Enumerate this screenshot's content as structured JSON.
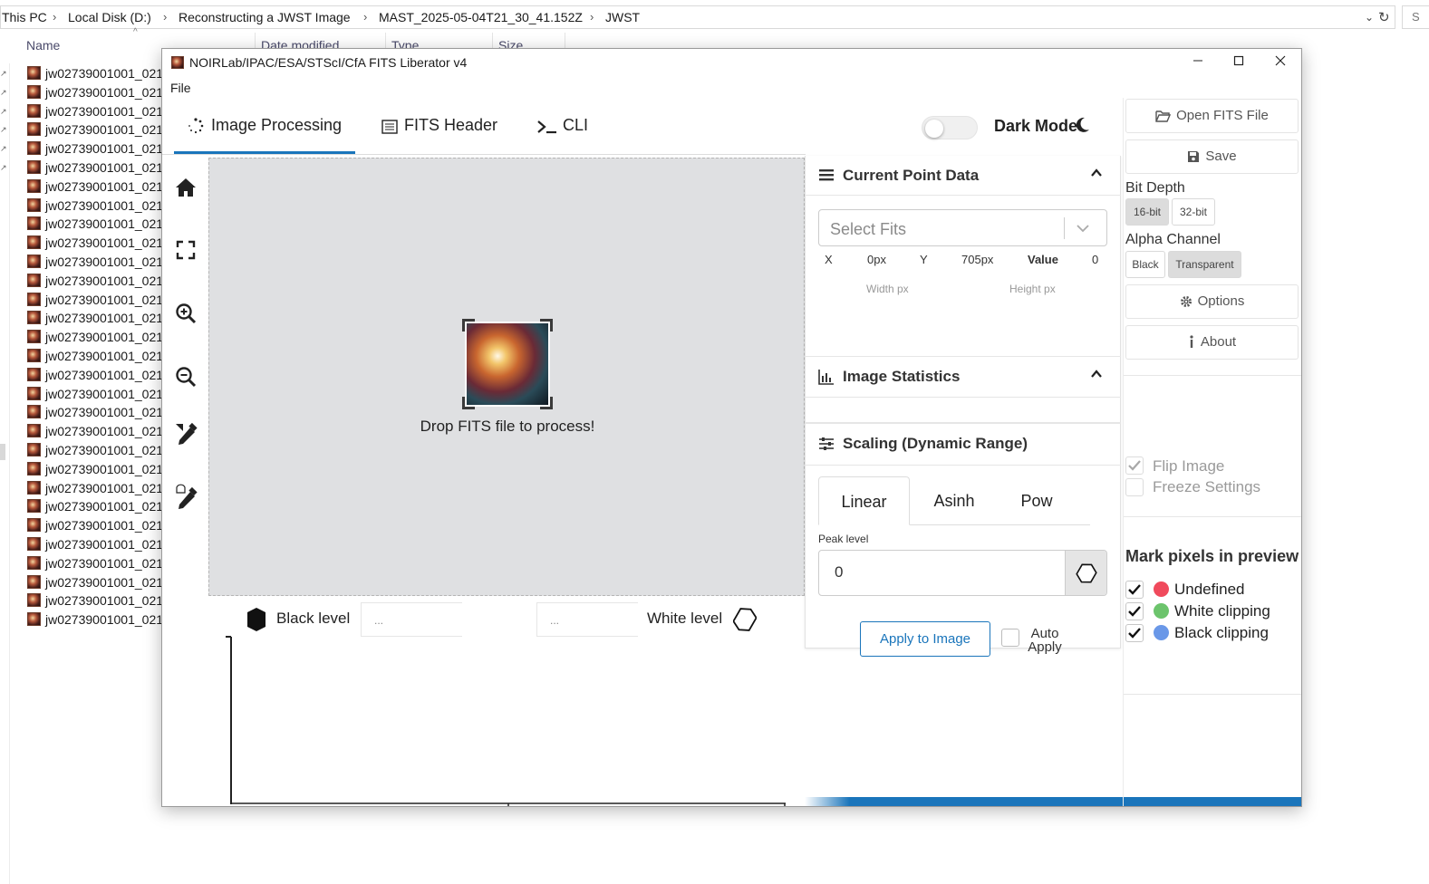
{
  "explorer": {
    "breadcrumbs": [
      "This PC",
      "Local Disk (D:)",
      "Reconstructing a JWST Image",
      "MAST_2025-05-04T21_30_41.152Z",
      "JWST"
    ],
    "search_placeholder": "S",
    "columns": [
      "Name",
      "Date modified",
      "Type",
      "Size"
    ],
    "file_label": "jw02739001001_021"
  },
  "app": {
    "title": "NOIRLab/IPAC/ESA/STScI/CfA FITS Liberator v4",
    "menu": [
      "File"
    ],
    "tabs": [
      {
        "label": "Image Processing",
        "icon": "spinner-icon",
        "active": true
      },
      {
        "label": "FITS Header",
        "icon": "list-icon",
        "active": false
      },
      {
        "label": "CLI",
        "icon": "terminal-icon",
        "active": false
      }
    ],
    "dark_mode": {
      "label": "Dark Mode",
      "on": false
    },
    "tools": [
      "home-icon",
      "fullscreen-icon",
      "zoom-in-icon",
      "zoom-out-icon",
      "eyedropper-black-icon",
      "eyedropper-white-icon"
    ],
    "drop_text": "Drop FITS file to process!",
    "levels": {
      "black_label": "Black level",
      "black_value": "...",
      "white_value": "...",
      "white_label": "White level"
    },
    "point_data": {
      "title": "Current Point Data",
      "select_placeholder": "Select Fits",
      "x_label": "X",
      "x_value": "0px",
      "y_label": "Y",
      "y_value": "705px",
      "value_label": "Value",
      "value": "0",
      "width_label": "Width px",
      "height_label": "Height px"
    },
    "image_stats": {
      "title": "Image Statistics"
    },
    "scaling": {
      "title": "Scaling (Dynamic Range)",
      "tabs": [
        "Linear",
        "Asinh",
        "Pow"
      ],
      "active_tab": "Linear",
      "peak_label": "Peak level",
      "peak_value": "0",
      "apply_label": "Apply to Image",
      "auto_apply_line1": "Auto",
      "auto_apply_line2": "Apply",
      "auto_apply_checked": false
    },
    "sidebar": {
      "open_label": "Open FITS File",
      "save_label": "Save",
      "bit_depth_label": "Bit Depth",
      "bit_depth_options": [
        "16-bit",
        "32-bit"
      ],
      "bit_depth_selected": "16-bit",
      "alpha_label": "Alpha Channel",
      "alpha_options": [
        "Black",
        "Transparent"
      ],
      "alpha_selected": "Transparent",
      "options_label": "Options",
      "about_label": "About",
      "flip_label": "Flip Image",
      "flip_checked": true,
      "freeze_label": "Freeze Settings",
      "freeze_checked": false,
      "mark_title": "Mark pixels in preview",
      "marks": [
        {
          "label": "Undefined",
          "color": "#f04a5c",
          "checked": true
        },
        {
          "label": "White clipping",
          "color": "#6cc46c",
          "checked": true
        },
        {
          "label": "Black clipping",
          "color": "#6a98e8",
          "checked": true
        }
      ]
    },
    "accent_color": "#1a75bb"
  }
}
